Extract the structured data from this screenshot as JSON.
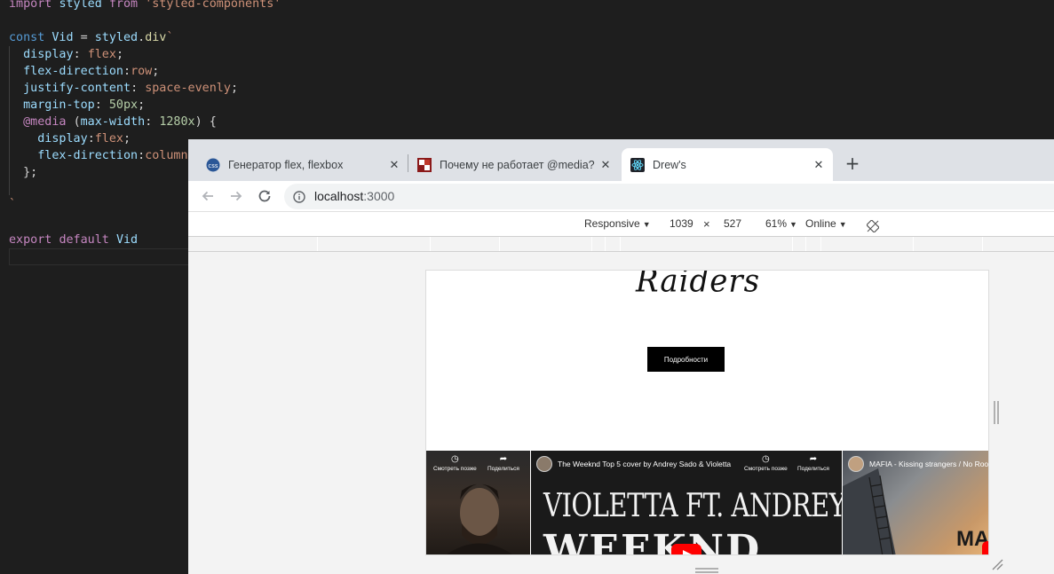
{
  "editor": {
    "lines": [
      {
        "id": "l1",
        "text": "import styled from 'styled-components'"
      },
      {
        "id": "l3",
        "text": "const Vid = styled.div`"
      },
      {
        "id": "l4",
        "text": "  display: flex;"
      },
      {
        "id": "l5",
        "text": "  flex-direction:row;"
      },
      {
        "id": "l6",
        "text": "  justify-content: space-evenly;"
      },
      {
        "id": "l7",
        "text": "  margin-top: 50px;"
      },
      {
        "id": "l8",
        "text": "  @media (max-width: 1280x) {"
      },
      {
        "id": "l9",
        "text": "    display:flex;"
      },
      {
        "id": "l10",
        "text": "    flex-direction:column;"
      },
      {
        "id": "l11",
        "text": "  };"
      },
      {
        "id": "l13",
        "text": "`"
      },
      {
        "id": "l15",
        "text": "export default Vid"
      }
    ]
  },
  "browser": {
    "tabs": [
      {
        "title": "Генератор flex, flexbox",
        "favicon": "css-generator-icon",
        "close": "✕"
      },
      {
        "title": "Почему не работает @media? -",
        "favicon": "question-site-icon",
        "close": "✕"
      },
      {
        "title": "Drew's",
        "favicon": "react-icon",
        "close": "✕"
      }
    ],
    "new_tab": "+",
    "url_host": "localhost",
    "url_port": ":3000"
  },
  "devtools": {
    "device": "Responsive",
    "width": "1039",
    "times": "×",
    "height": "527",
    "zoom": "61%",
    "network": "Online",
    "caret": "▼"
  },
  "page": {
    "logo_text": "Raiders",
    "details_button": "Подробности",
    "videos": [
      {
        "title": "",
        "watch_later": "Смотреть позже",
        "share": "Поделиться"
      },
      {
        "title": "The Weeknd Top 5 cover by Andrey Sado & Violetta",
        "watch_later": "Смотреть позже",
        "share": "Поделиться",
        "thumb_line1": "VIOLETTA FT. ANDREY SADO",
        "thumb_line2": "WEEKND"
      },
      {
        "title": "MAFIA - Kissing strangers / No Root",
        "thumb_text": "MA"
      }
    ]
  },
  "colors": {
    "editor_bg": "#1e1e1e",
    "tabstrip_bg": "#dee1e6",
    "youtube_red": "#ff0000"
  }
}
